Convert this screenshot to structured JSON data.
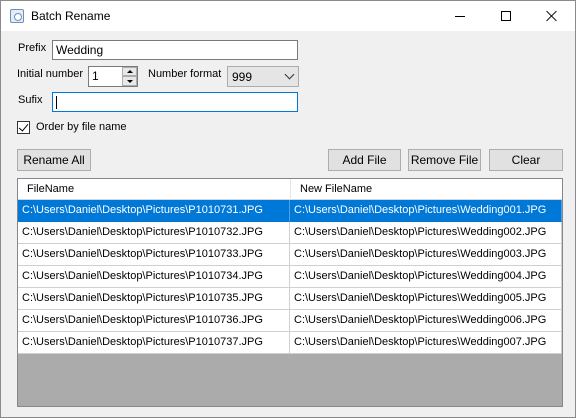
{
  "window": {
    "title": "Batch Rename"
  },
  "form": {
    "prefix_label": "Prefix",
    "prefix_value": "Wedding",
    "initial_number_label": "Initial number",
    "initial_number_value": "1",
    "number_format_label": "Number format",
    "number_format_value": "999",
    "suffix_label": "Sufix",
    "suffix_value": "",
    "order_checkbox_label": "Order by file name",
    "order_checkbox_checked": true
  },
  "buttons": {
    "rename_all": "Rename All",
    "add_file": "Add File",
    "remove_file": "Remove File",
    "clear": "Clear"
  },
  "grid": {
    "columns": [
      "FileName",
      "New FileName"
    ],
    "selected_row": 0,
    "rows": [
      [
        "C:\\Users\\Daniel\\Desktop\\Pictures\\P1010731.JPG",
        "C:\\Users\\Daniel\\Desktop\\Pictures\\Wedding001.JPG"
      ],
      [
        "C:\\Users\\Daniel\\Desktop\\Pictures\\P1010732.JPG",
        "C:\\Users\\Daniel\\Desktop\\Pictures\\Wedding002.JPG"
      ],
      [
        "C:\\Users\\Daniel\\Desktop\\Pictures\\P1010733.JPG",
        "C:\\Users\\Daniel\\Desktop\\Pictures\\Wedding003.JPG"
      ],
      [
        "C:\\Users\\Daniel\\Desktop\\Pictures\\P1010734.JPG",
        "C:\\Users\\Daniel\\Desktop\\Pictures\\Wedding004.JPG"
      ],
      [
        "C:\\Users\\Daniel\\Desktop\\Pictures\\P1010735.JPG",
        "C:\\Users\\Daniel\\Desktop\\Pictures\\Wedding005.JPG"
      ],
      [
        "C:\\Users\\Daniel\\Desktop\\Pictures\\P1010736.JPG",
        "C:\\Users\\Daniel\\Desktop\\Pictures\\Wedding006.JPG"
      ],
      [
        "C:\\Users\\Daniel\\Desktop\\Pictures\\P1010737.JPG",
        "C:\\Users\\Daniel\\Desktop\\Pictures\\Wedding007.JPG"
      ]
    ]
  },
  "colors": {
    "selection": "#0078d7",
    "window_background": "#f0f0f0",
    "grid_background": "#ababab"
  }
}
